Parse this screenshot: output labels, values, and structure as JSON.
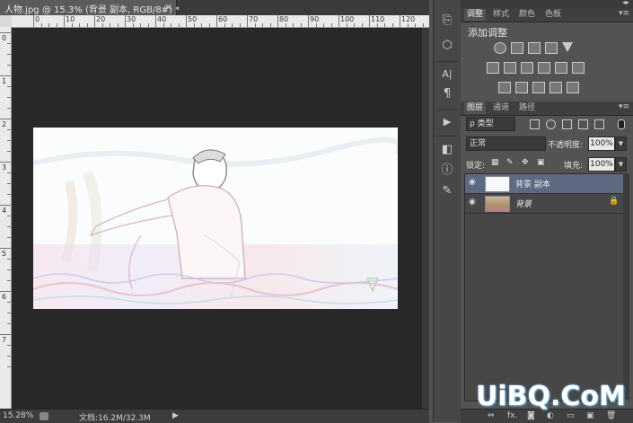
{
  "document": {
    "tab_title": "人物.jpg @ 15.3% (背景 副本, RGB/8#) *",
    "close_glyph": "×"
  },
  "rulers": {
    "top_labels": [
      "0",
      "10",
      "20",
      "30",
      "40",
      "50",
      "60",
      "70",
      "80",
      "90",
      "100",
      "110",
      "120"
    ],
    "left_labels": [
      "0",
      "1",
      "2",
      "3",
      "4",
      "5",
      "6",
      "7"
    ]
  },
  "status": {
    "zoom": "15.28%",
    "doc_size": "文档:16.2M/32.3M",
    "arrow": "▶"
  },
  "tools": {
    "items": [
      {
        "name": "history-icon",
        "glyph": "⎘"
      },
      {
        "name": "3d-cube-icon",
        "glyph": "⬡"
      },
      {
        "name": "character-icon",
        "glyph": "A|"
      },
      {
        "name": "paragraph-icon",
        "glyph": "¶"
      },
      {
        "name": "play-actions-icon",
        "glyph": "▶"
      },
      {
        "name": "layer-comps-icon",
        "glyph": "◧"
      },
      {
        "name": "info-icon",
        "glyph": "ⓘ"
      },
      {
        "name": "brush-presets-icon",
        "glyph": "✎"
      }
    ]
  },
  "adjust_panel": {
    "tabs": [
      "调整",
      "样式",
      "颜色",
      "色板"
    ],
    "title": "添加调整",
    "menu_glyph": "▾≡",
    "collapse_glyph": "◂▸"
  },
  "layers_panel": {
    "tabs": [
      "图层",
      "通道",
      "路径"
    ],
    "menu_glyph": "▾≡",
    "filter_label": "ρ 类型",
    "blend_mode": "正常",
    "opacity_label": "不透明度:",
    "opacity_value": "100%",
    "lock_label": "锁定:",
    "fill_label": "填充:",
    "fill_value": "100%",
    "layers": [
      {
        "name": "背景 副本",
        "selected": true,
        "italic": false,
        "locked": false
      },
      {
        "name": "背景",
        "selected": false,
        "italic": true,
        "locked": true
      }
    ],
    "bottom_icons": [
      "⇔",
      "fx.",
      "◙",
      "◐",
      "▭",
      "▣",
      "🗑"
    ]
  },
  "watermark": {
    "text": "UiBQ.CoM"
  },
  "colors": {
    "selected_layer": "#5c6a82",
    "panel_bg": "#535353",
    "canvas_bg": "#282828"
  }
}
